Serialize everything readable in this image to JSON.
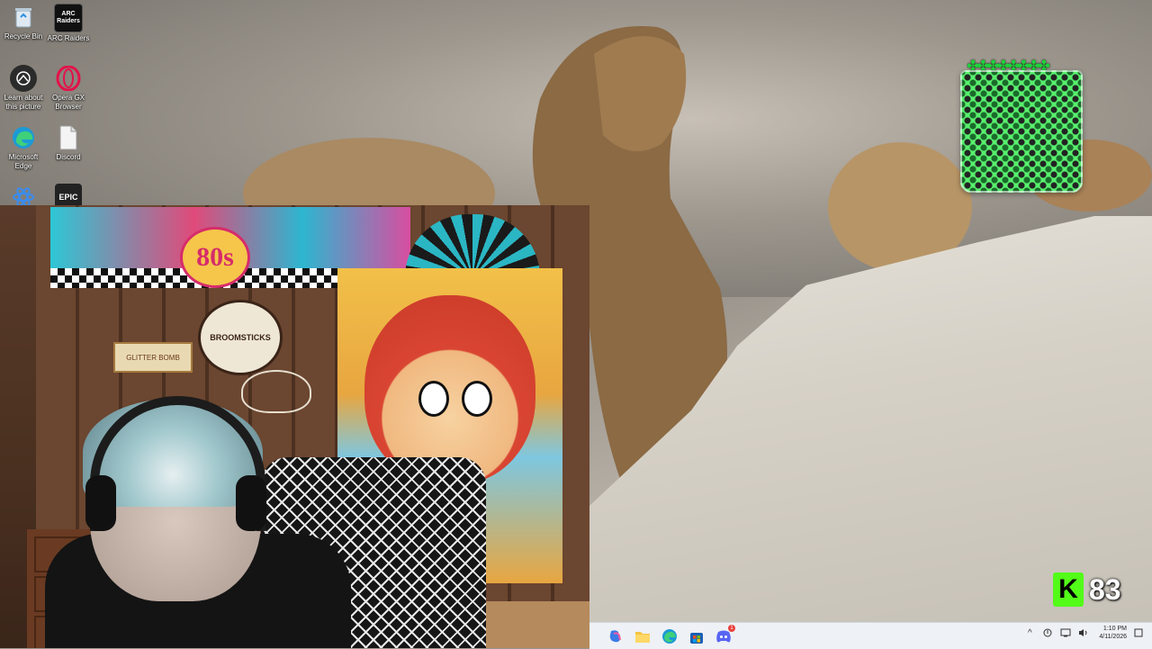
{
  "desktop": {
    "icons": [
      {
        "label": "Recycle Bin",
        "icon": "recycle-bin-icon"
      },
      {
        "label": "ARC Raiders",
        "icon": "arc-raiders-icon",
        "glyph_text": "ARC Raiders"
      },
      {
        "label": "Learn about this picture",
        "icon": "camera-icon"
      },
      {
        "label": "Opera GX Browser",
        "icon": "opera-gx-icon"
      },
      {
        "label": "Microsoft Edge",
        "icon": "edge-icon"
      },
      {
        "label": "Discord",
        "icon": "file-icon"
      },
      {
        "label": "",
        "icon": "atom-app-icon"
      },
      {
        "label": "",
        "icon": "epic-games-icon",
        "glyph_text": "EPIC"
      }
    ]
  },
  "webcam": {
    "banner_text": "80s",
    "sign_text": "BROOMSTICKS",
    "glitter_text": "GLITTER BOMB"
  },
  "kick": {
    "logo": "K",
    "count": "83"
  },
  "taskbar": {
    "apps": [
      {
        "name": "copilot-icon"
      },
      {
        "name": "file-explorer-icon"
      },
      {
        "name": "edge-icon"
      },
      {
        "name": "microsoft-store-icon"
      },
      {
        "name": "discord-icon",
        "badge": "1"
      }
    ],
    "clock": {
      "time": "1:10 PM",
      "date": "4/11/2026"
    }
  },
  "colors": {
    "kick_green": "#53fc18",
    "taskbar_bg": "#eef1f6"
  }
}
